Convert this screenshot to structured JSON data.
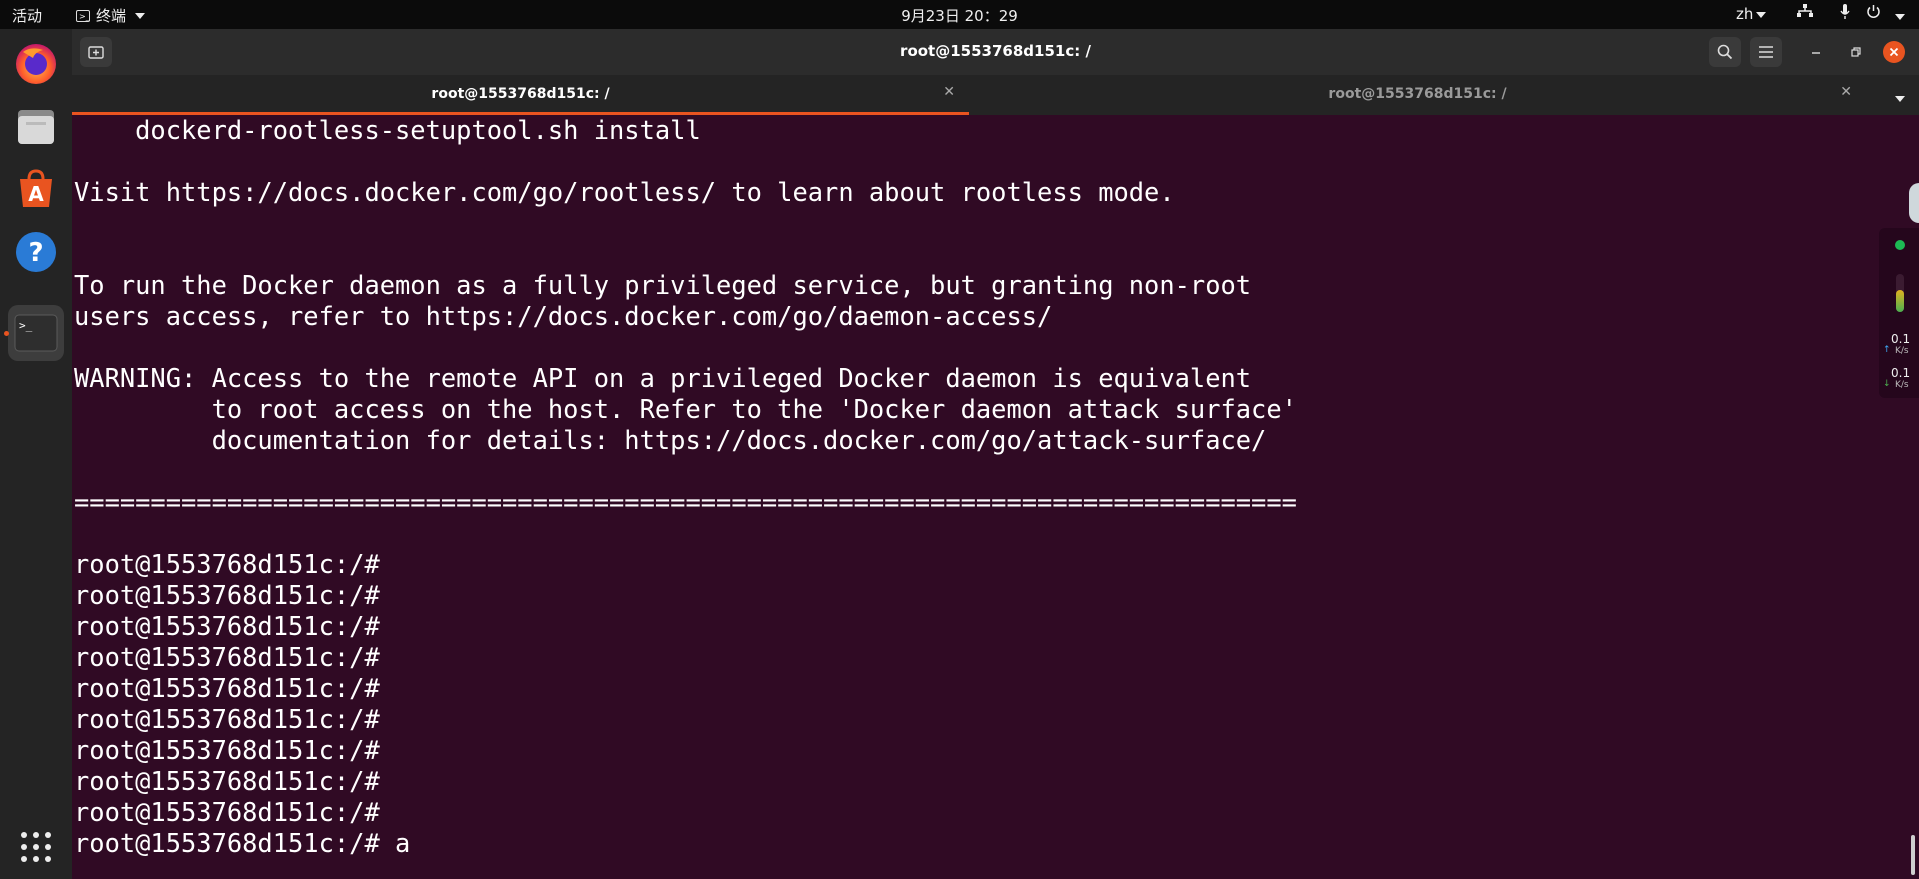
{
  "topbar": {
    "activities": "活动",
    "app_menu": "终端",
    "clock": "9月23日  20：29",
    "language": "zh"
  },
  "window": {
    "title": "root@1553768d151c: /",
    "tabs": [
      {
        "label": "root@1553768d151c: /",
        "active": true
      },
      {
        "label": "root@1553768d151c: /",
        "active": false
      }
    ]
  },
  "terminal": {
    "lines": [
      "    dockerd-rootless-setuptool.sh install",
      "",
      "Visit https://docs.docker.com/go/rootless/ to learn about rootless mode.",
      "",
      "",
      "To run the Docker daemon as a fully privileged service, but granting non-root",
      "users access, refer to https://docs.docker.com/go/daemon-access/",
      "",
      "WARNING: Access to the remote API on a privileged Docker daemon is equivalent",
      "         to root access on the host. Refer to the 'Docker daemon attack surface'",
      "         documentation for details: https://docs.docker.com/go/attack-surface/",
      "",
      "================================================================================",
      "",
      "root@1553768d151c:/#",
      "root@1553768d151c:/#",
      "root@1553768d151c:/#",
      "root@1553768d151c:/#",
      "root@1553768d151c:/#",
      "root@1553768d151c:/#",
      "root@1553768d151c:/#",
      "root@1553768d151c:/#",
      "root@1553768d151c:/#",
      "root@1553768d151c:/# a"
    ]
  },
  "netspeed": {
    "up_value": "0.1",
    "up_unit": "K/s",
    "down_value": "0.1",
    "down_unit": "K/s"
  },
  "dock": {
    "items": [
      "firefox-icon",
      "files-icon",
      "software-icon",
      "help-icon",
      "terminal-icon",
      "app-grid-icon"
    ]
  },
  "colors": {
    "terminal_bg": "#300a24",
    "accent": "#e95420",
    "topbar_bg": "#0b0b0b",
    "dock_bg": "#242424"
  }
}
